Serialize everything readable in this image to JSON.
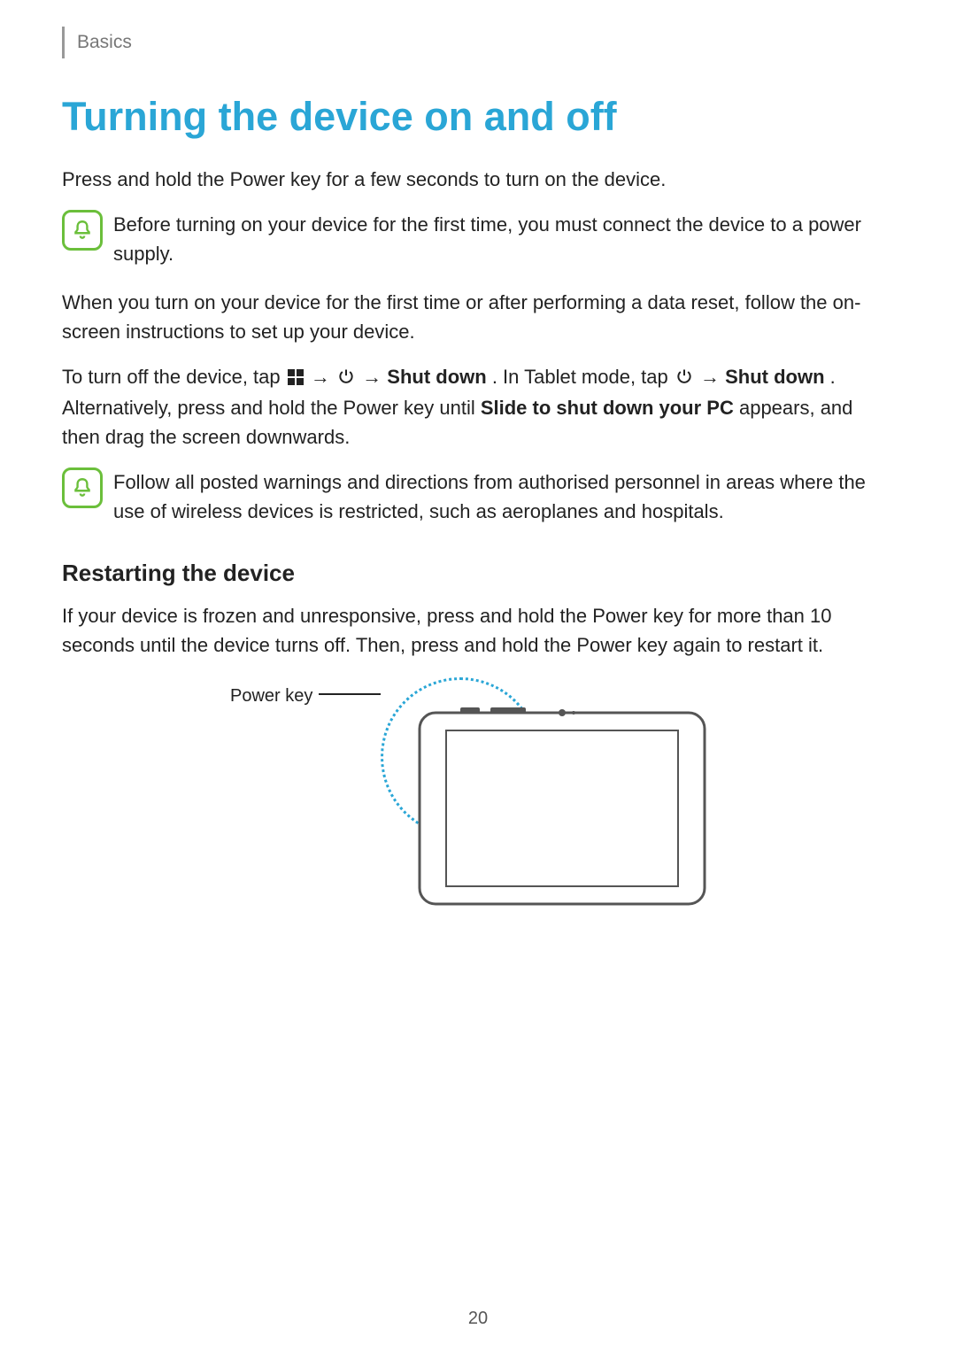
{
  "header": {
    "section": "Basics"
  },
  "title": "Turning the device on and off",
  "intro": "Press and hold the Power key for a few seconds to turn on the device.",
  "note1": "Before turning on your device for the first time, you must connect the device to a power supply.",
  "para_firsttime": "When you turn on your device for the first time or after performing a data reset, follow the on-screen instructions to set up your device.",
  "turnoff": {
    "pre": "To turn off the device, tap ",
    "arrow1": " → ",
    "arrow2": " → ",
    "shutdown1": "Shut down",
    "mid1": ". In Tablet mode, tap ",
    "arrow3": " → ",
    "shutdown2": "Shut down",
    "mid2": ". Alternatively, press and hold the Power key until ",
    "slide": "Slide to shut down your PC",
    "post": " appears, and then drag the screen downwards."
  },
  "note2": "Follow all posted warnings and directions from authorised personnel in areas where the use of wireless devices is restricted, such as aeroplanes and hospitals.",
  "restart": {
    "heading": "Restarting the device",
    "body": "If your device is frozen and unresponsive, press and hold the Power key for more than 10 seconds until the device turns off. Then, press and hold the Power key again to restart it."
  },
  "figure": {
    "label": "Power key"
  },
  "page_number": "20"
}
